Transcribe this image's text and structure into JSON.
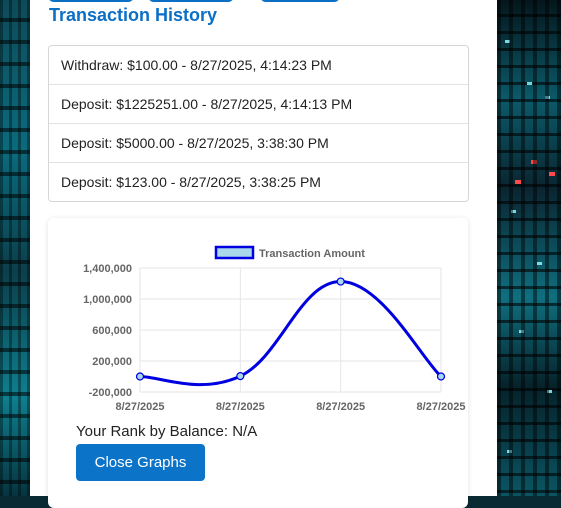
{
  "page": {
    "title": "Transaction History"
  },
  "transactions": [
    {
      "text": "Withdraw: $100.00 - 8/27/2025, 4:14:23 PM"
    },
    {
      "text": "Deposit: $1225251.00 - 8/27/2025, 4:14:13 PM"
    },
    {
      "text": "Deposit: $5000.00 - 8/27/2025, 3:38:30 PM"
    },
    {
      "text": "Deposit: $123.00 - 8/27/2025, 3:38:25 PM"
    }
  ],
  "rank": {
    "text": "Your Rank by Balance: N/A"
  },
  "buttons": {
    "close_graphs": "Close Graphs"
  },
  "colors": {
    "accent": "#0b6fc6",
    "line": "#0000e0",
    "legend_fill": "#a8d8ea"
  },
  "chart_data": {
    "type": "line",
    "categories": [
      "8/27/2025",
      "8/27/2025",
      "8/27/2025",
      "8/27/2025"
    ],
    "series": [
      {
        "name": "Transaction Amount",
        "values": [
          123,
          5000,
          1225251,
          -100
        ]
      }
    ],
    "yticks": [
      "1,400,000",
      "1,000,000",
      "600,000",
      "200,000",
      "-200,000"
    ],
    "ylim": [
      -200000,
      1400000
    ],
    "grid": true,
    "legend": "top"
  }
}
